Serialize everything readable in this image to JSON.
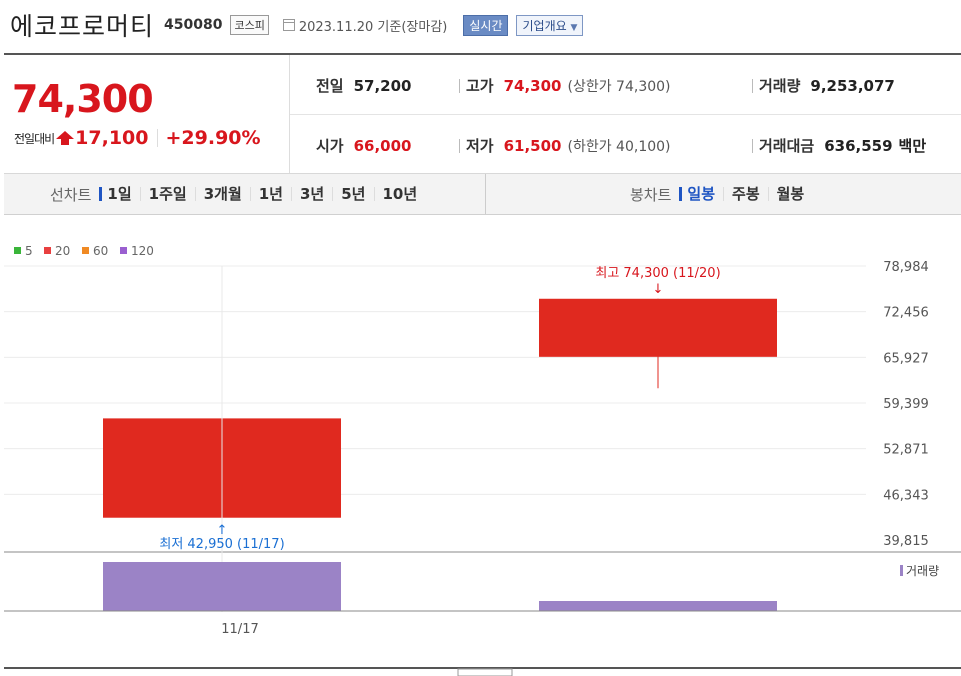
{
  "header": {
    "name": "에코프로머티",
    "code": "450080",
    "market": "코스피",
    "date": "2023.11.20 기준(장마감)",
    "realtime": "실시간",
    "profile": "기업개요"
  },
  "summary": {
    "price": "74,300",
    "change_label": "전일대비",
    "change": "17,100",
    "change_pct": "+29.90%",
    "prev": {
      "label": "전일",
      "value": "57,200"
    },
    "high": {
      "label": "고가",
      "value": "74,300",
      "extra": "(상한가 74,300)"
    },
    "volume": {
      "label": "거래량",
      "value": "9,253,077"
    },
    "open": {
      "label": "시가",
      "value": "66,000"
    },
    "low": {
      "label": "저가",
      "value": "61,500",
      "extra": "(하한가 40,100)"
    },
    "amount": {
      "label": "거래대금",
      "value": "636,559",
      "unit": "백만"
    }
  },
  "periods": {
    "line_label": "선차트",
    "line_items": [
      "1일",
      "1주일",
      "3개월",
      "1년",
      "3년",
      "5년",
      "10년"
    ],
    "candle_label": "봉차트",
    "candle_items": [
      "일봉",
      "주봉",
      "월봉"
    ]
  },
  "colors": {
    "up": "#e0291f",
    "volume": "#9b83c6",
    "ma5": "#3ab53a",
    "ma20": "#e84040",
    "ma60": "#f08a24",
    "ma120": "#9a5fd0",
    "min_label": "#1a6fd3"
  },
  "chart_data": {
    "type": "candlestick",
    "legend": [
      "5",
      "20",
      "60",
      "120"
    ],
    "ylim": [
      39815,
      78984
    ],
    "yticks": [
      "78,984",
      "72,456",
      "65,927",
      "59,399",
      "52,871",
      "46,343",
      "39,815"
    ],
    "ytick_values": [
      78984,
      72456,
      65927,
      59399,
      52871,
      46343,
      39815
    ],
    "candles": [
      {
        "date": "11/17",
        "open": 43000,
        "high": 66000,
        "low": 42950,
        "close": 57200,
        "volume": 0.98
      },
      {
        "date": "11/20",
        "open": 66000,
        "high": 74300,
        "low": 61500,
        "close": 74300,
        "volume": 0.2
      }
    ],
    "xtick_labels": [
      "11/17"
    ],
    "annotations": {
      "high": "최고 74,300 (11/20)",
      "low": "최저 42,950 (11/17)",
      "high_arrow": "↓",
      "low_arrow": "↑"
    },
    "volume_label": "거래량"
  }
}
